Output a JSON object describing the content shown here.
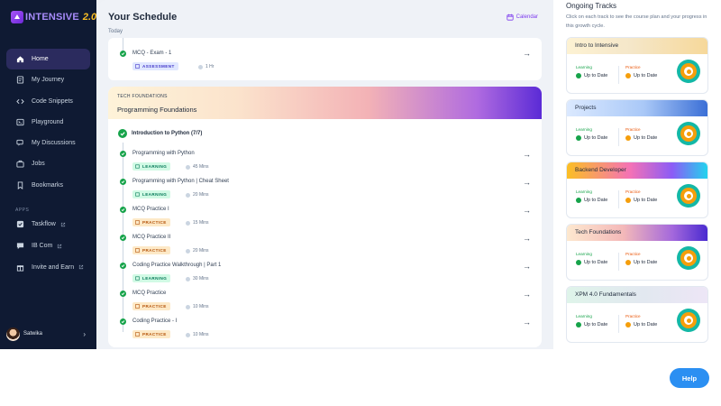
{
  "brand": {
    "name": "INTENSIVE",
    "version": "2.0"
  },
  "nav": [
    {
      "label": "Home",
      "icon": "home-icon",
      "active": true
    },
    {
      "label": "My Journey",
      "icon": "journey-icon"
    },
    {
      "label": "Code Snippets",
      "icon": "code-icon"
    },
    {
      "label": "Playground",
      "icon": "terminal-icon"
    },
    {
      "label": "My Discussions",
      "icon": "discussion-icon"
    },
    {
      "label": "Jobs",
      "icon": "briefcase-icon"
    },
    {
      "label": "Bookmarks",
      "icon": "bookmark-icon"
    }
  ],
  "apps_label": "APPS",
  "apps": [
    {
      "label": "Taskflow",
      "icon": "check-square-icon"
    },
    {
      "label": "IB Com",
      "icon": "chat-icon"
    },
    {
      "label": "Invite and Earn",
      "icon": "gift-icon"
    }
  ],
  "user": {
    "name": "Satwika"
  },
  "schedule": {
    "title": "Your Schedule",
    "today": "Today",
    "calendar_label": "Calendar",
    "top_item": {
      "title": "MCQ - Exam - 1",
      "badge": "ASSESSMENT",
      "duration": "1 Hr"
    },
    "track": {
      "kicker": "TECH FOUNDATIONS",
      "name": "Programming Foundations",
      "section": "Introduction to Python (7/7)",
      "items": [
        {
          "title": "Programming with Python",
          "badge": "LEARNING",
          "duration": "45 Mins"
        },
        {
          "title": "Programming with Python | Cheat Sheet",
          "badge": "LEARNING",
          "duration": "20 Mins"
        },
        {
          "title": "MCQ Practice I",
          "badge": "PRACTICE",
          "duration": "15 Mins"
        },
        {
          "title": "MCQ Practice II",
          "badge": "PRACTICE",
          "duration": "20 Mins"
        },
        {
          "title": "Coding Practice Walkthrough | Part 1",
          "badge": "LEARNING",
          "duration": "30 Mins"
        },
        {
          "title": "MCQ Practice",
          "badge": "PRACTICE",
          "duration": "10 Mins"
        },
        {
          "title": "Coding Practice - I",
          "badge": "PRACTICE",
          "duration": "10 Mins"
        }
      ]
    }
  },
  "ongoing": {
    "title": "Ongoing Tracks",
    "subtitle": "Click on each track to see the course plan and your progress in this growth cycle.",
    "learning_label": "Learning",
    "practice_label": "Practice",
    "status": "Up to Date",
    "tracks": [
      {
        "name": "Intro to Intensive",
        "gradient": "linear-gradient(90deg,#fdf2d3,#f5e7c9 45%,#f6d89a)"
      },
      {
        "name": "Projects",
        "gradient": "linear-gradient(90deg,#dbe9ff,#a9c8f7 55%,#3b6fd6)"
      },
      {
        "name": "Backend Developer",
        "gradient": "linear-gradient(90deg,#fbbf24,#f472b6 45%,#8b5cf6 75%,#22d3ee)"
      },
      {
        "name": "Tech Foundations",
        "gradient": "linear-gradient(90deg,#fde8cf,#f4b9b9 40%,#a468dc 75%,#4a2bd0)"
      },
      {
        "name": "XPM 4.0 Fundamentals",
        "gradient": "linear-gradient(90deg,#dff4ea,#e2e8f0 55%,#ede6f6)"
      }
    ]
  },
  "help_label": "Help"
}
